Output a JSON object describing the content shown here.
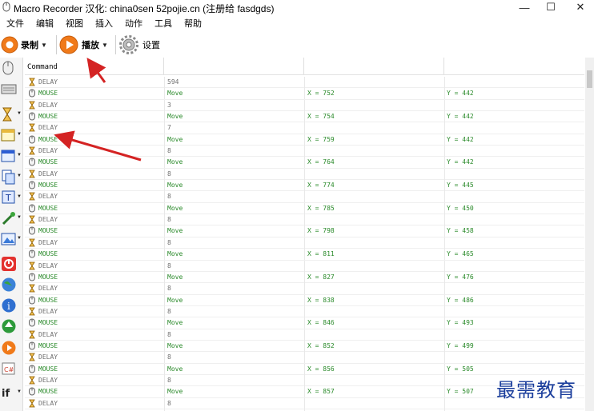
{
  "window": {
    "title": "Macro Recorder 汉化: china0sen 52pojie.cn (注册给 fasdgds)",
    "controls": [
      "—",
      "☐",
      "✕"
    ]
  },
  "menu": [
    "文件",
    "编辑",
    "视图",
    "插入",
    "动作",
    "工具",
    "帮助"
  ],
  "toolbar": {
    "record_label": "录制",
    "play_label": "播放",
    "settings_label": "设置"
  },
  "sidebar_icons": [
    "mouse-icon",
    "keyboard-icon",
    "delay-icon",
    "window-icon",
    "window-resize-icon",
    "copy-icon",
    "text-icon",
    "color-picker-icon",
    "image-icon",
    "stop-icon",
    "web-icon",
    "info-icon",
    "download-icon",
    "play-icon",
    "code-icon",
    "if-icon"
  ],
  "table": {
    "header": "Command",
    "rows": [
      {
        "type": "DELAY",
        "c1": "594",
        "c2": "",
        "c3": ""
      },
      {
        "type": "MOUSE",
        "c1": "Move",
        "c2": "X = 752",
        "c3": "Y = 442"
      },
      {
        "type": "DELAY",
        "c1": "3",
        "c2": "",
        "c3": ""
      },
      {
        "type": "MOUSE",
        "c1": "Move",
        "c2": "X = 754",
        "c3": "Y = 442"
      },
      {
        "type": "DELAY",
        "c1": "7",
        "c2": "",
        "c3": ""
      },
      {
        "type": "MOUSE",
        "c1": "Move",
        "c2": "X = 759",
        "c3": "Y = 442"
      },
      {
        "type": "DELAY",
        "c1": "8",
        "c2": "",
        "c3": ""
      },
      {
        "type": "MOUSE",
        "c1": "Move",
        "c2": "X = 764",
        "c3": "Y = 442"
      },
      {
        "type": "DELAY",
        "c1": "8",
        "c2": "",
        "c3": ""
      },
      {
        "type": "MOUSE",
        "c1": "Move",
        "c2": "X = 774",
        "c3": "Y = 445"
      },
      {
        "type": "DELAY",
        "c1": "8",
        "c2": "",
        "c3": ""
      },
      {
        "type": "MOUSE",
        "c1": "Move",
        "c2": "X = 785",
        "c3": "Y = 450"
      },
      {
        "type": "DELAY",
        "c1": "8",
        "c2": "",
        "c3": ""
      },
      {
        "type": "MOUSE",
        "c1": "Move",
        "c2": "X = 798",
        "c3": "Y = 458"
      },
      {
        "type": "DELAY",
        "c1": "8",
        "c2": "",
        "c3": ""
      },
      {
        "type": "MOUSE",
        "c1": "Move",
        "c2": "X = 811",
        "c3": "Y = 465"
      },
      {
        "type": "DELAY",
        "c1": "8",
        "c2": "",
        "c3": ""
      },
      {
        "type": "MOUSE",
        "c1": "Move",
        "c2": "X = 827",
        "c3": "Y = 476"
      },
      {
        "type": "DELAY",
        "c1": "8",
        "c2": "",
        "c3": ""
      },
      {
        "type": "MOUSE",
        "c1": "Move",
        "c2": "X = 838",
        "c3": "Y = 486"
      },
      {
        "type": "DELAY",
        "c1": "8",
        "c2": "",
        "c3": ""
      },
      {
        "type": "MOUSE",
        "c1": "Move",
        "c2": "X = 846",
        "c3": "Y = 493"
      },
      {
        "type": "DELAY",
        "c1": "8",
        "c2": "",
        "c3": ""
      },
      {
        "type": "MOUSE",
        "c1": "Move",
        "c2": "X = 852",
        "c3": "Y = 499"
      },
      {
        "type": "DELAY",
        "c1": "8",
        "c2": "",
        "c3": ""
      },
      {
        "type": "MOUSE",
        "c1": "Move",
        "c2": "X = 856",
        "c3": "Y = 505"
      },
      {
        "type": "DELAY",
        "c1": "8",
        "c2": "",
        "c3": ""
      },
      {
        "type": "MOUSE",
        "c1": "Move",
        "c2": "X = 857",
        "c3": "Y = 507"
      },
      {
        "type": "DELAY",
        "c1": "8",
        "c2": "",
        "c3": ""
      },
      {
        "type": "",
        "c1": "",
        "c2": "",
        "c3": ""
      }
    ]
  },
  "watermark": "最需教育",
  "colors": {
    "mouse_text": "#2a8a2a",
    "delay_text": "#707070",
    "arrow": "#d42323",
    "watermark": "#1b3e9c"
  }
}
